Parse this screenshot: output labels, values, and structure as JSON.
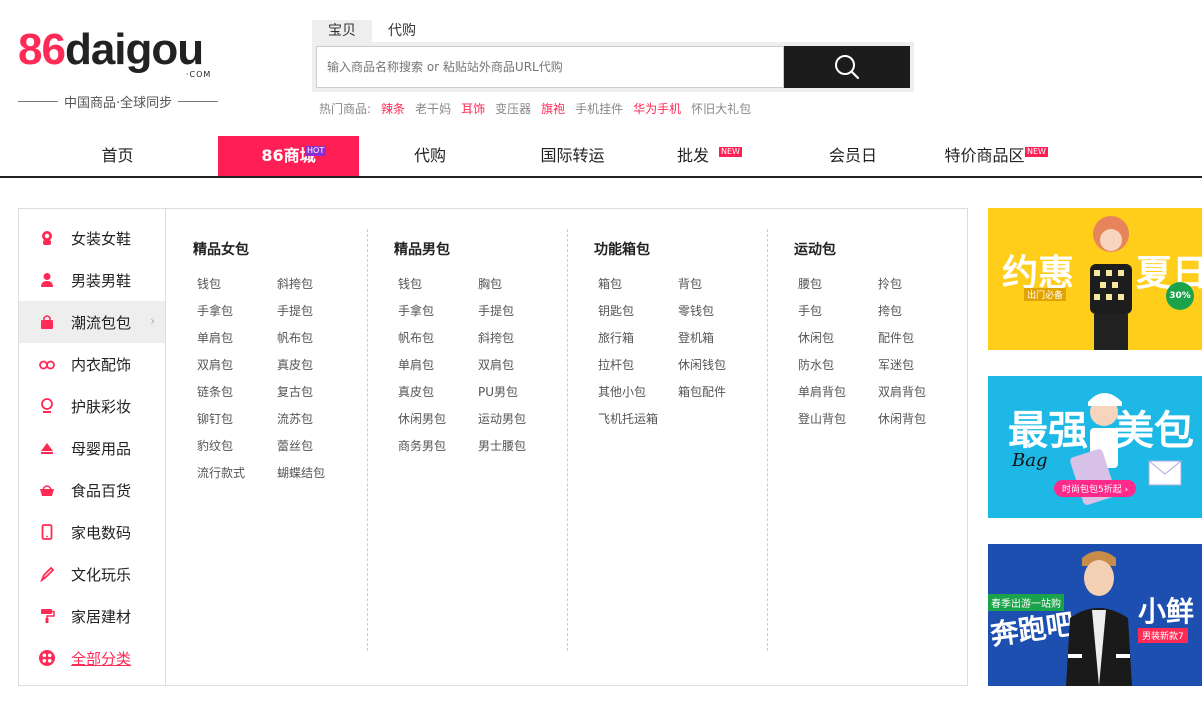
{
  "logo": {
    "num": "86",
    "word": "daigou",
    "com": "·COM",
    "slogan": "中国商品·全球同步"
  },
  "search": {
    "tabs": [
      "宝贝",
      "代购"
    ],
    "placeholder": "输入商品名称搜索 or 粘贴站外商品URL代购",
    "hot_label": "热门商品:",
    "hot": [
      {
        "text": "辣条",
        "red": true
      },
      {
        "text": "老干妈",
        "red": false
      },
      {
        "text": "耳饰",
        "red": true
      },
      {
        "text": "变压器",
        "red": false
      },
      {
        "text": "旗袍",
        "red": true
      },
      {
        "text": "手机挂件",
        "red": false
      },
      {
        "text": "华为手机",
        "red": true
      },
      {
        "text": "怀旧大礼包",
        "red": false
      }
    ]
  },
  "nav": {
    "items": [
      "首页",
      "86商城",
      "代购",
      "国际转运",
      "批发",
      "会员日",
      "特价商品区"
    ],
    "hot_badge": "HOT",
    "new_badge": "NEW"
  },
  "sidebar": {
    "items": [
      "女装女鞋",
      "男装男鞋",
      "潮流包包",
      "内衣配饰",
      "护肤彩妆",
      "母婴用品",
      "食品百货",
      "家电数码",
      "文化玩乐",
      "家居建材",
      "全部分类"
    ]
  },
  "columns": [
    {
      "title": "精品女包",
      "links": [
        "钱包",
        "斜挎包",
        "手拿包",
        "手提包",
        "单肩包",
        "帆布包",
        "双肩包",
        "真皮包",
        "链条包",
        "复古包",
        "铆钉包",
        "流苏包",
        "豹纹包",
        "蕾丝包",
        "流行款式",
        "蝴蝶结包"
      ]
    },
    {
      "title": "精品男包",
      "links": [
        "钱包",
        "胸包",
        "手拿包",
        "手提包",
        "帆布包",
        "斜挎包",
        "单肩包",
        "双肩包",
        "真皮包",
        "PU男包",
        "休闲男包",
        "运动男包",
        "商务男包",
        "男士腰包"
      ]
    },
    {
      "title": "功能箱包",
      "links": [
        "箱包",
        "背包",
        "钥匙包",
        "零钱包",
        "旅行箱",
        "登机箱",
        "拉杆包",
        "休闲钱包",
        "其他小包",
        "箱包配件",
        "飞机托运箱"
      ]
    },
    {
      "title": "运动包",
      "links": [
        "腰包",
        "拎包",
        "手包",
        "挎包",
        "休闲包",
        "配件包",
        "防水包",
        "军迷包",
        "单肩背包",
        "双肩背包",
        "登山背包",
        "休闲背包"
      ]
    }
  ],
  "banners": [
    {
      "big_left": "约惠",
      "big_right": "夏日",
      "sub": "出门必备",
      "tag": "30%"
    },
    {
      "big_left": "最强",
      "big_right": "美包",
      "script": "Bag",
      "cta": "时尚包包5折起 ›"
    },
    {
      "top": "春季出游一站购",
      "big_left": "奔跑吧",
      "big_right": "小鲜",
      "tag": "男装新款7"
    }
  ],
  "colors": {
    "brand": "#ff2a55",
    "nav_active": "#ff1f55",
    "dark": "#1c1c1c"
  }
}
